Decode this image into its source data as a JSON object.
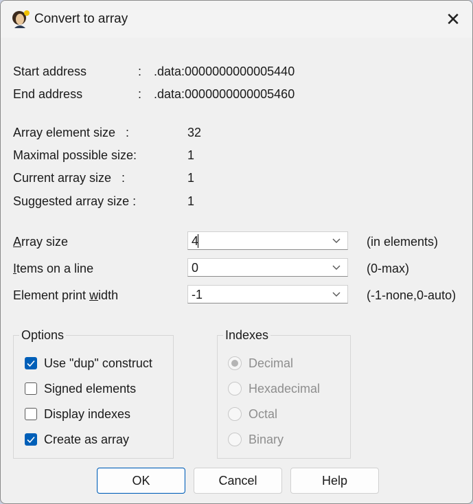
{
  "window": {
    "title": "Convert to array",
    "app_icon": "ida-lady-icon",
    "close_glyph": "✕"
  },
  "addresses": {
    "start_label": "Start address",
    "start_sep": ":",
    "start_value": ".data:0000000000005440",
    "end_label": "End address",
    "end_sep": ":",
    "end_value": ".data:0000000000005460"
  },
  "info": {
    "element_size_label": "Array element size   :",
    "element_size_value": "32",
    "max_size_label": "Maximal possible size:",
    "max_size_value": "1",
    "current_size_label": "Current array size   :",
    "current_size_value": "1",
    "suggested_size_label": "Suggested array size :",
    "suggested_size_value": "1"
  },
  "fields": {
    "array_size": {
      "label_first": "A",
      "label_rest": "rray size",
      "value": "4",
      "hint": "(in elements)"
    },
    "items_per_line": {
      "label_first": "I",
      "label_rest": "tems on a line",
      "value": "0",
      "hint": "(0-max)"
    },
    "print_width": {
      "label_pre": "Element print ",
      "label_u": "w",
      "label_post": "idth",
      "value": "-1",
      "hint": "(-1-none,0-auto)"
    }
  },
  "options": {
    "title": "Options",
    "items": [
      {
        "label": "Use \"dup\" construct",
        "checked": true
      },
      {
        "label": "Signed elements",
        "checked": false
      },
      {
        "label": "Display indexes",
        "checked": false
      },
      {
        "label": "Create as array",
        "checked": true
      }
    ]
  },
  "indexes": {
    "title": "Indexes",
    "disabled": true,
    "items": [
      {
        "label": "Decimal",
        "selected": true
      },
      {
        "label": "Hexadecimal",
        "selected": false
      },
      {
        "label": "Octal",
        "selected": false
      },
      {
        "label": "Binary",
        "selected": false
      }
    ]
  },
  "buttons": {
    "ok": "OK",
    "cancel": "Cancel",
    "help": "Help"
  },
  "colors": {
    "accent": "#005fb8",
    "dialog_bg": "#f0f0f0",
    "disabled_text": "#8e8e8e"
  }
}
